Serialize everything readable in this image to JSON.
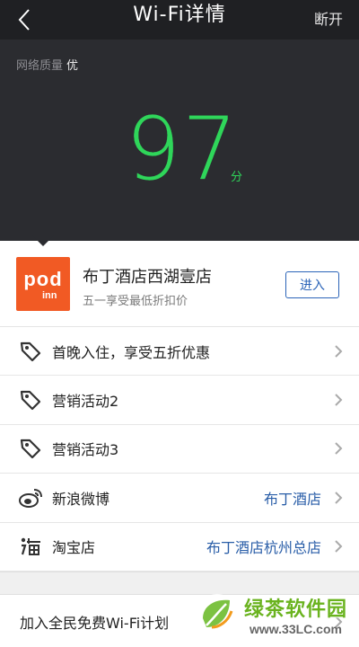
{
  "header": {
    "title": "Wi-Fi详情",
    "disconnect_label": "断开"
  },
  "network": {
    "quality_label": "网络质量",
    "quality_value": "优",
    "score": "97",
    "score_unit": "分"
  },
  "hotel": {
    "logo_top": "pod",
    "logo_bottom": "inn",
    "name": "布丁酒店西湖壹店",
    "subtitle": "五一享受最低折扣价",
    "enter_label": "进入",
    "logo_color": "#f15a24"
  },
  "list": [
    {
      "icon": "tag-icon",
      "label": "首晚入住，享受五折优惠",
      "value": ""
    },
    {
      "icon": "tag-icon",
      "label": "营销活动2",
      "value": ""
    },
    {
      "icon": "tag-icon",
      "label": "营销活动3",
      "value": ""
    },
    {
      "icon": "weibo-icon",
      "label": "新浪微博",
      "value": "布丁酒店"
    },
    {
      "icon": "taobao-icon",
      "label": "淘宝店",
      "value": "布丁酒店杭州总店"
    }
  ],
  "bottom": {
    "label": "加入全民免费Wi-Fi计划"
  },
  "watermark": {
    "text": "绿茶软件园",
    "url": "www.33LC.com"
  },
  "colors": {
    "accent_green": "#2fd65a",
    "link_blue": "#2a5ea8",
    "dark_bg": "#2b2c30"
  }
}
